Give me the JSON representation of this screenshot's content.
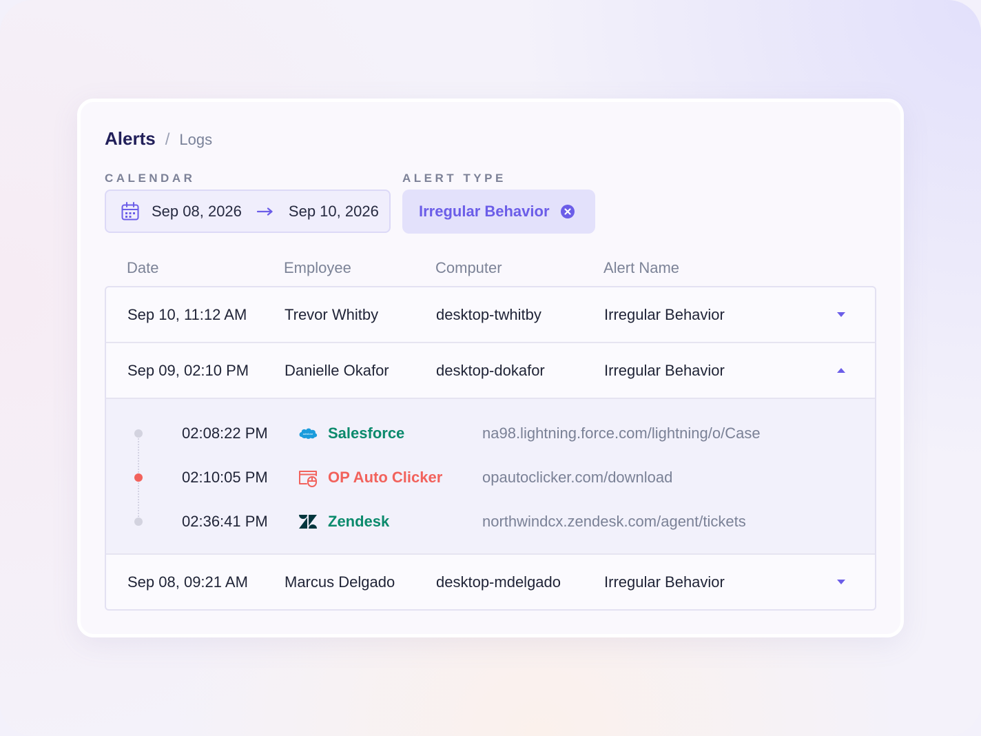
{
  "breadcrumb": {
    "current": "Alerts",
    "separator": "/",
    "sub": "Logs"
  },
  "filters": {
    "calendar_label": "CALENDAR",
    "date_from": "Sep 08, 2026",
    "date_to": "Sep 10, 2026",
    "alert_type_label": "ALERT TYPE",
    "alert_type_value": "Irregular Behavior"
  },
  "table": {
    "columns": [
      "Date",
      "Employee",
      "Computer",
      "Alert Name"
    ],
    "rows": [
      {
        "date": "Sep 10, 11:12 AM",
        "employee": "Trevor Whitby",
        "computer": "desktop-twhitby",
        "alert": "Irregular Behavior",
        "expanded": false
      },
      {
        "date": "Sep 09, 02:10 PM",
        "employee": "Danielle Okafor",
        "computer": "desktop-dokafor",
        "alert": "Irregular Behavior",
        "expanded": true
      },
      {
        "date": "Sep 08, 09:21 AM",
        "employee": "Marcus Delgado",
        "computer": "desktop-mdelgado",
        "alert": "Irregular Behavior",
        "expanded": false
      }
    ],
    "details": [
      {
        "time": "02:08:22 PM",
        "app": "Salesforce",
        "icon": "salesforce-icon",
        "url": "na98.lightning.force.com/lightning/o/Case",
        "color": "#0b8a6c",
        "dot": "#d3d3df"
      },
      {
        "time": "02:10:05 PM",
        "app": "OP Auto Clicker",
        "icon": "auto-clicker-icon",
        "url": "opautoclicker.com/download",
        "color": "#f2625c",
        "dot": "#f2625c"
      },
      {
        "time": "02:36:41 PM",
        "app": "Zendesk",
        "icon": "zendesk-icon",
        "url": "northwindcx.zendesk.com/agent/tickets",
        "color": "#0b8a6c",
        "dot": "#d3d3df"
      }
    ]
  },
  "colors": {
    "accent": "#6b5de8",
    "heading": "#22205a",
    "alert_red": "#f2625c",
    "app_green": "#0b8a6c"
  }
}
